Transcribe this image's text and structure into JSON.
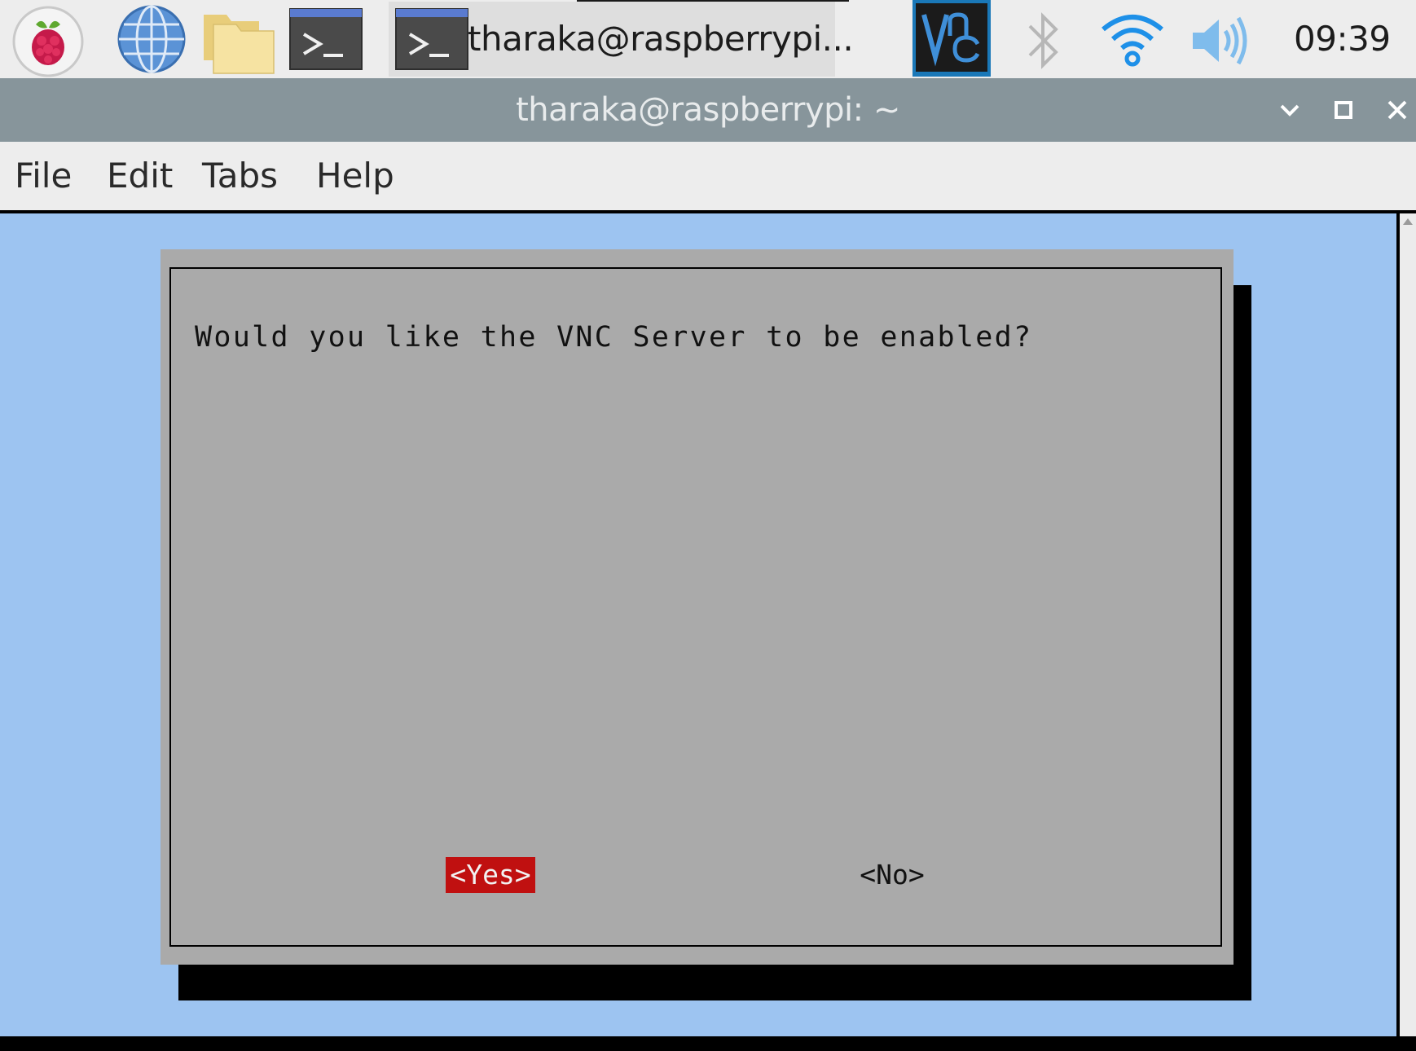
{
  "taskbar": {
    "launchers": [
      {
        "name": "raspberry-menu-icon"
      },
      {
        "name": "globe-browser-icon"
      },
      {
        "name": "folder-icon"
      },
      {
        "name": "terminal-icon"
      }
    ],
    "active_task": {
      "label": "tharaka@raspberrypi...",
      "icon": "terminal-icon"
    },
    "tray": {
      "vnc_icon": "vnc-icon",
      "bluetooth_icon": "bluetooth-icon",
      "wifi_icon": "wifi-icon",
      "volume_icon": "volume-icon",
      "clock": "09:39"
    }
  },
  "window": {
    "title": "tharaka@raspberrypi: ~",
    "controls": [
      "chevron-down-icon",
      "maximize-icon",
      "close-icon"
    ]
  },
  "menubar": {
    "file": "File",
    "edit": "Edit",
    "tabs": "Tabs",
    "help": "Help"
  },
  "dialog": {
    "question": "Would you like the VNC Server to be enabled?",
    "yes_label": "<Yes>",
    "no_label": "<No>",
    "selected": "yes"
  },
  "colors": {
    "titlebar": "#87959b",
    "terminal_bg": "#9dc4f1",
    "dialog_bg": "#aaaaaa",
    "selected_button": "#c01010",
    "vnc_accent": "#1a78b8"
  }
}
